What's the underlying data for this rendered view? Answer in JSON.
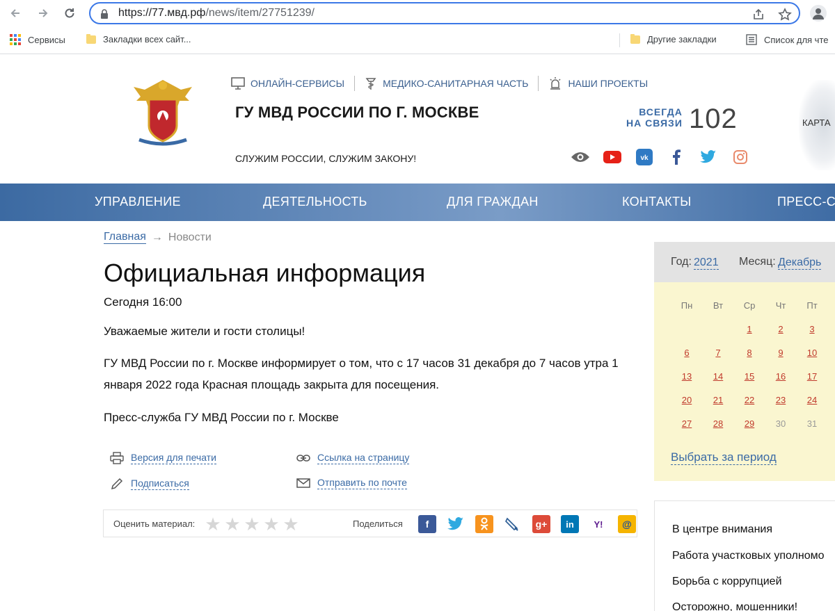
{
  "browser": {
    "url_prefix": "https://77.мвд.рф",
    "url_path": "/news/item/27751239/",
    "bookmarks": [
      {
        "label": "Сервисы"
      },
      {
        "label": "Закладки всех сайт..."
      },
      {
        "label": "Другие закладки"
      },
      {
        "label": "Список для чте"
      }
    ]
  },
  "header": {
    "top_links": [
      "ОНЛАЙН-СЕРВИСЫ",
      "МЕДИКО-САНИТАРНАЯ ЧАСТЬ",
      "НАШИ ПРОЕКТЫ"
    ],
    "title": "ГУ МВД РОССИИ ПО Г. МОСКВЕ",
    "slogan": "СЛУЖИМ РОССИИ, СЛУЖИМ ЗАКОНУ!",
    "hotline_line1": "ВСЕГДА",
    "hotline_line2": "НА СВЯЗИ",
    "hotline_number": "102",
    "map_label": "КАРТА",
    "socials": [
      "eye-icon",
      "youtube-icon",
      "vk-icon",
      "facebook-icon",
      "twitter-icon",
      "instagram-icon"
    ]
  },
  "nav": {
    "items": [
      "УПРАВЛЕНИЕ",
      "ДЕЯТЕЛЬНОСТЬ",
      "ДЛЯ ГРАЖДАН",
      "КОНТАКТЫ",
      "ПРЕСС-СЛ"
    ]
  },
  "breadcrumb": {
    "home": "Главная",
    "arrow": "→",
    "current": "Новости"
  },
  "article": {
    "title": "Официальная информация",
    "date": "Сегодня 16:00",
    "p1": "Уважаемые жители и гости столицы!",
    "p2": "ГУ МВД России по г. Москве информирует о том, что с 17 часов 31 декабря до 7 часов утра 1 января 2022 года Красная площадь закрыта для посещения.",
    "p3": "Пресс-служба ГУ МВД России по г. Москве"
  },
  "actions": {
    "print": "Версия для печати",
    "link": "Ссылка на страницу",
    "subscribe": "Подписаться",
    "email": "Отправить по почте"
  },
  "rating": {
    "label": "Оценить материал:",
    "stars": 5,
    "share_label": "Поделиться",
    "share_icons": [
      "facebook-share-icon",
      "twitter-share-icon",
      "odnoklassniki-share-icon",
      "livejournal-share-icon",
      "googleplus-share-icon",
      "linkedin-share-icon",
      "yahoo-share-icon",
      "mail-share-icon"
    ]
  },
  "calendar": {
    "year_label": "Год:",
    "year": "2021",
    "month_label": "Месяц:",
    "month": "Декабрь",
    "dows": [
      "Пн",
      "Вт",
      "Ср",
      "Чт",
      "Пт"
    ],
    "weeks": [
      [
        "",
        "",
        "1",
        "2",
        "3"
      ],
      [
        "6",
        "7",
        "8",
        "9",
        "10"
      ],
      [
        "13",
        "14",
        "15",
        "16",
        "17"
      ],
      [
        "20",
        "21",
        "22",
        "23",
        "24"
      ],
      [
        "27",
        "28",
        "29",
        "30",
        "31"
      ]
    ],
    "inactive": [
      "30",
      "31"
    ],
    "period_link": "Выбрать за период"
  },
  "sidebar": {
    "items": [
      "В центре внимания",
      "Работа участковых уполномо",
      "Борьба с коррупцией",
      "Осторожно, мошенники!"
    ]
  }
}
